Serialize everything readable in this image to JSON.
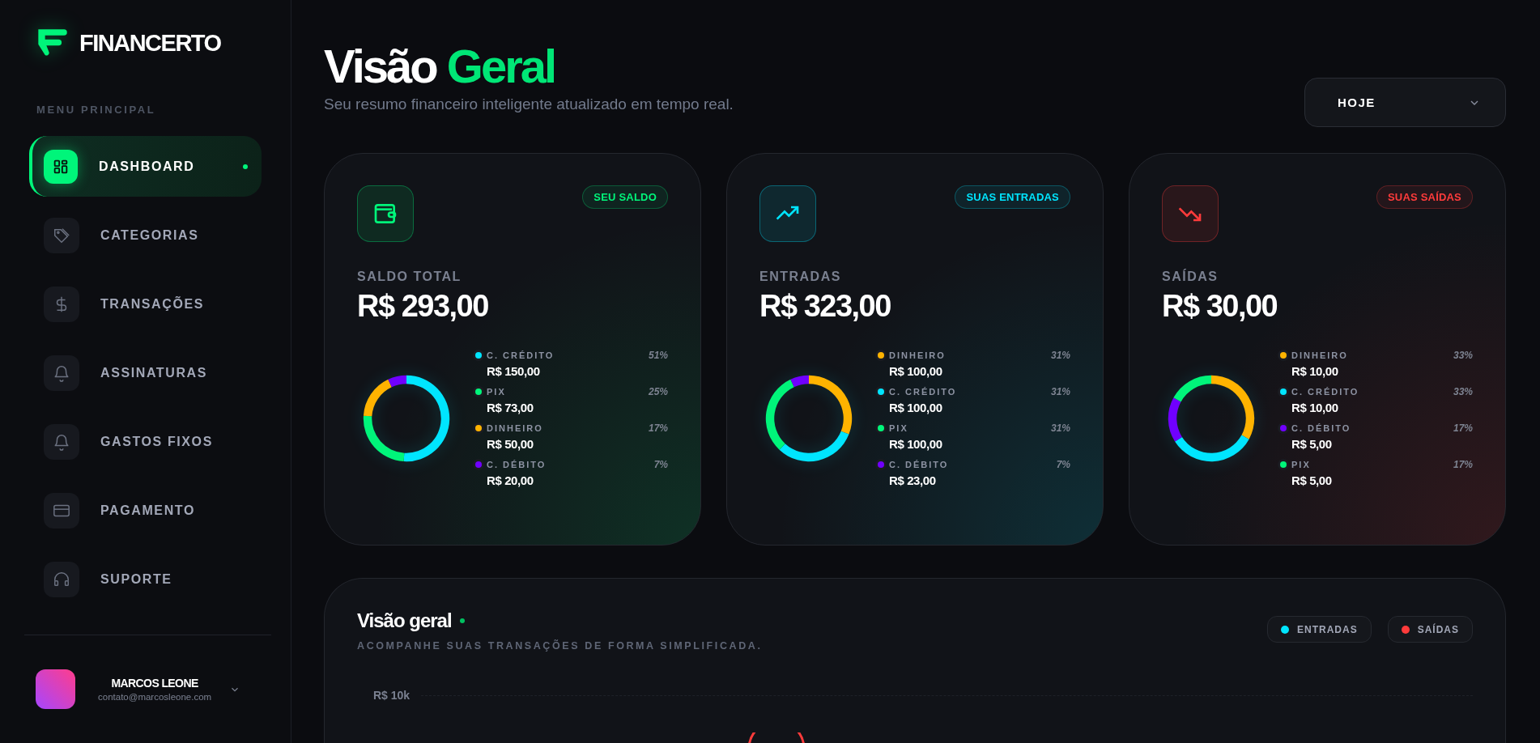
{
  "brand": {
    "name": "FINANCERTO"
  },
  "sidebar": {
    "section_label": "MENU PRINCIPAL",
    "items": [
      {
        "label": "DASHBOARD",
        "kind": "grid",
        "selected": true
      },
      {
        "label": "CATEGORIAS",
        "kind": "tag",
        "selected": false
      },
      {
        "label": "TRANSAÇÕES",
        "kind": "dollar",
        "selected": false
      },
      {
        "label": "ASSINATURAS",
        "kind": "bell",
        "selected": false
      },
      {
        "label": "GASTOS FIXOS",
        "kind": "bell",
        "selected": false
      },
      {
        "label": "PAGAMENTO",
        "kind": "card",
        "selected": false
      },
      {
        "label": "SUPORTE",
        "kind": "headset",
        "selected": false
      }
    ],
    "user": {
      "name": "MARCOS LEONE",
      "email": "contato@marcosleone.com"
    }
  },
  "header": {
    "title": "Visão",
    "title_accent": "Geral",
    "subtitle": "Seu resumo financeiro inteligente atualizado em tempo real.",
    "period": {
      "value": "HOJE"
    }
  },
  "cards": [
    {
      "kind": "wallet",
      "color": "#00f57a",
      "badge": "SEU SALDO",
      "label": "SALDO TOTAL",
      "amount": "R$ 293,00",
      "legend": [
        {
          "color": "#00e5ff",
          "amount": "R$ 150,00",
          "percent": "51%"
        },
        {
          "color": "#00f57a",
          "amount": "R$ 73,00",
          "percent": "25%"
        },
        {
          "color": "#ffb300",
          "amount": "R$ 50,00",
          "percent": "17%"
        },
        {
          "color": "#7000ff",
          "amount": "R$ 20,00",
          "percent": "7%"
        }
      ],
      "chart_data": {
        "type": "donut",
        "categories": [
          "C. CRÉDITO",
          "PIX",
          "DINHEIRO",
          "C. DÉBITO"
        ],
        "values": [
          51,
          25,
          17,
          7
        ]
      }
    },
    {
      "kind": "trend-up",
      "color": "#00e5ff",
      "badge": "SUAS ENTRADAS",
      "label": "ENTRADAS",
      "amount": "R$ 323,00",
      "legend": [
        {
          "color": "#ffb300",
          "amount": "R$ 100,00",
          "percent": "31%"
        },
        {
          "color": "#00e5ff",
          "amount": "R$ 100,00",
          "percent": "31%"
        },
        {
          "color": "#00f57a",
          "amount": "R$ 100,00",
          "percent": "31%"
        },
        {
          "color": "#7000ff",
          "amount": "R$ 23,00",
          "percent": "7%"
        }
      ],
      "chart_data": {
        "type": "donut",
        "categories": [
          "DINHEIRO",
          "C. CRÉDITO",
          "PIX",
          "C. DÉBITO"
        ],
        "values": [
          31,
          31,
          31,
          7
        ]
      }
    },
    {
      "kind": "trend-down",
      "color": "#ff3b3b",
      "badge": "SUAS SAÍDAS",
      "label": "SAÍDAS",
      "amount": "R$ 30,00",
      "legend": [
        {
          "color": "#ffb300",
          "amount": "R$ 10,00",
          "percent": "33%"
        },
        {
          "color": "#00e5ff",
          "amount": "R$ 10,00",
          "percent": "33%"
        },
        {
          "color": "#7000ff",
          "amount": "R$ 5,00",
          "percent": "17%"
        },
        {
          "color": "#00f57a",
          "amount": "R$ 5,00",
          "percent": "17%"
        }
      ],
      "chart_data": {
        "type": "donut",
        "categories": [
          "DINHEIRO",
          "C. CRÉDITO",
          "C. DÉBITO",
          "PIX"
        ],
        "values": [
          33,
          33,
          17,
          17
        ]
      }
    }
  ],
  "overview": {
    "title": "Visão geral",
    "subtitle": "ACOMPANHE SUAS TRANSAÇÕES DE FORMA SIMPLIFICADA.",
    "legend": [
      {
        "name": "ENTRADAS",
        "color": "#00e5ff"
      },
      {
        "name": "SAÍDAS",
        "color": "#ff3b3b"
      }
    ],
    "y_label": "R$ 10k"
  }
}
